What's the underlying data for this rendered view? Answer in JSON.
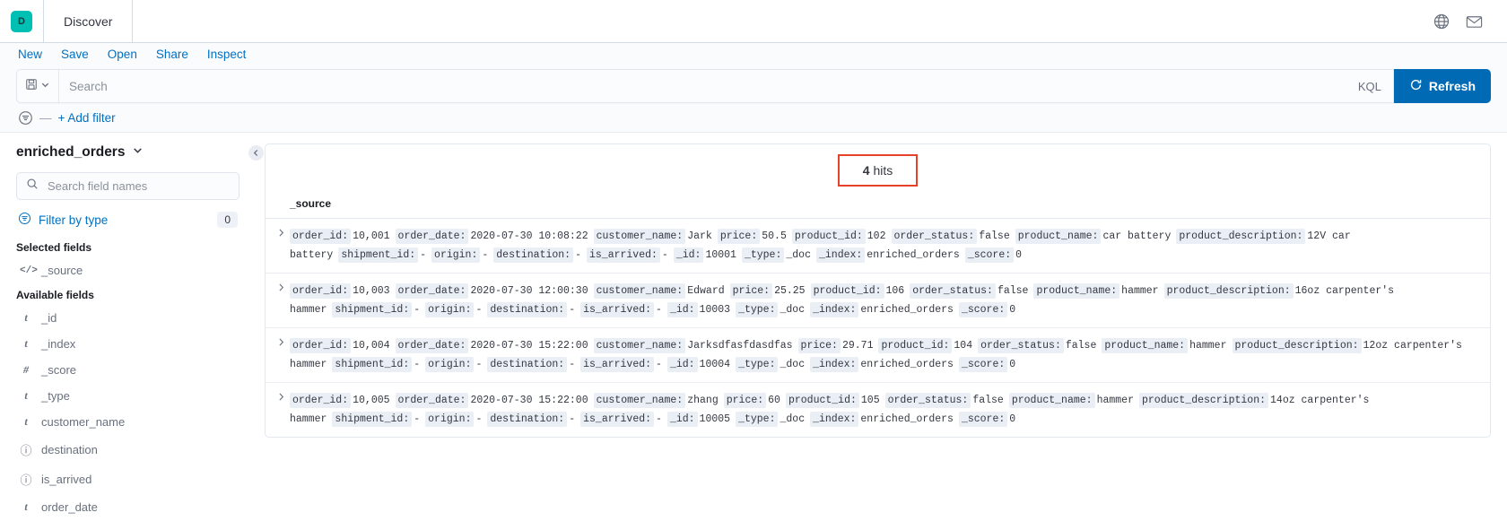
{
  "topbar": {
    "logo_letter": "D",
    "app_title": "Discover",
    "globe_icon": "globe-icon",
    "mail_icon": "mail-icon"
  },
  "menu": {
    "items": [
      {
        "label": "New",
        "name": "menu-new"
      },
      {
        "label": "Save",
        "name": "menu-save"
      },
      {
        "label": "Open",
        "name": "menu-open"
      },
      {
        "label": "Share",
        "name": "menu-share"
      },
      {
        "label": "Inspect",
        "name": "menu-inspect"
      }
    ]
  },
  "query_bar": {
    "saved_query_icon": "save-disk-icon",
    "chevron_icon": "chevron-down-icon",
    "search_value": "",
    "search_placeholder": "Search",
    "language_label": "KQL",
    "refresh_label": "Refresh",
    "refresh_icon": "refresh-icon",
    "refresh_color": "#006bb4"
  },
  "filter_bar": {
    "filter_icon": "filter-icon",
    "separator": "—",
    "add_filter_label": "+ Add filter"
  },
  "sidebar": {
    "index_pattern": "enriched_orders",
    "index_chevron_icon": "chevron-down-icon",
    "field_search_value": "",
    "field_search_placeholder": "Search field names",
    "search_icon": "search-icon",
    "filter_by_type_label": "Filter by type",
    "filter_by_type_icon": "filter-icon",
    "filter_by_type_count": "0",
    "selected_fields_label": "Selected fields",
    "selected_fields": [
      {
        "name": "_source",
        "type_glyph": "</>",
        "type": "source"
      }
    ],
    "available_fields_label": "Available fields",
    "available_fields": [
      {
        "name": "_id",
        "type_glyph": "t",
        "type": "string"
      },
      {
        "name": "_index",
        "type_glyph": "t",
        "type": "string"
      },
      {
        "name": "_score",
        "type_glyph": "#",
        "type": "number"
      },
      {
        "name": "_type",
        "type_glyph": "t",
        "type": "string"
      },
      {
        "name": "customer_name",
        "type_glyph": "t",
        "type": "string"
      },
      {
        "name": "destination",
        "type_glyph": "ⓘ",
        "type": "unknown"
      },
      {
        "name": "is_arrived",
        "type_glyph": "ⓘ",
        "type": "unknown"
      },
      {
        "name": "order_date",
        "type_glyph": "t",
        "type": "string"
      }
    ],
    "collapse_icon": "collapse-panel-icon"
  },
  "results": {
    "hits_count": "4",
    "hits_label": "hits",
    "hits_highlight_color": "#e7412b",
    "column_header": "_source",
    "expand_icon": "chevron-right-icon",
    "rows": [
      {
        "fields": [
          {
            "key": "order_id",
            "value": "10,001"
          },
          {
            "key": "order_date",
            "value": "2020-07-30 10:08:22"
          },
          {
            "key": "customer_name",
            "value": "Jark"
          },
          {
            "key": "price",
            "value": "50.5"
          },
          {
            "key": "product_id",
            "value": "102"
          },
          {
            "key": "order_status",
            "value": "false"
          },
          {
            "key": "product_name",
            "value": "car battery"
          },
          {
            "key": "product_description",
            "value": "12V car battery"
          },
          {
            "key": "shipment_id",
            "value": "-"
          },
          {
            "key": "origin",
            "value": "-"
          },
          {
            "key": "destination",
            "value": "-"
          },
          {
            "key": "is_arrived",
            "value": "-"
          },
          {
            "key": "_id",
            "value": "10001"
          },
          {
            "key": "_type",
            "value": "_doc"
          },
          {
            "key": "_index",
            "value": "enriched_orders"
          },
          {
            "key": "_score",
            "value": "0"
          }
        ]
      },
      {
        "fields": [
          {
            "key": "order_id",
            "value": "10,003"
          },
          {
            "key": "order_date",
            "value": "2020-07-30 12:00:30"
          },
          {
            "key": "customer_name",
            "value": "Edward"
          },
          {
            "key": "price",
            "value": "25.25"
          },
          {
            "key": "product_id",
            "value": "106"
          },
          {
            "key": "order_status",
            "value": "false"
          },
          {
            "key": "product_name",
            "value": "hammer"
          },
          {
            "key": "product_description",
            "value": "16oz carpenter's hammer"
          },
          {
            "key": "shipment_id",
            "value": "-"
          },
          {
            "key": "origin",
            "value": "-"
          },
          {
            "key": "destination",
            "value": "-"
          },
          {
            "key": "is_arrived",
            "value": "-"
          },
          {
            "key": "_id",
            "value": "10003"
          },
          {
            "key": "_type",
            "value": "_doc"
          },
          {
            "key": "_index",
            "value": "enriched_orders"
          },
          {
            "key": "_score",
            "value": "0"
          }
        ]
      },
      {
        "fields": [
          {
            "key": "order_id",
            "value": "10,004"
          },
          {
            "key": "order_date",
            "value": "2020-07-30 15:22:00"
          },
          {
            "key": "customer_name",
            "value": "Jarksdfasfdasdfas"
          },
          {
            "key": "price",
            "value": "29.71"
          },
          {
            "key": "product_id",
            "value": "104"
          },
          {
            "key": "order_status",
            "value": "false"
          },
          {
            "key": "product_name",
            "value": "hammer"
          },
          {
            "key": "product_description",
            "value": "12oz carpenter's hammer"
          },
          {
            "key": "shipment_id",
            "value": "-"
          },
          {
            "key": "origin",
            "value": "-"
          },
          {
            "key": "destination",
            "value": "-"
          },
          {
            "key": "is_arrived",
            "value": "-"
          },
          {
            "key": "_id",
            "value": "10004"
          },
          {
            "key": "_type",
            "value": "_doc"
          },
          {
            "key": "_index",
            "value": "enriched_orders"
          },
          {
            "key": "_score",
            "value": "0"
          }
        ]
      },
      {
        "fields": [
          {
            "key": "order_id",
            "value": "10,005"
          },
          {
            "key": "order_date",
            "value": "2020-07-30 15:22:00"
          },
          {
            "key": "customer_name",
            "value": "zhang"
          },
          {
            "key": "price",
            "value": "60"
          },
          {
            "key": "product_id",
            "value": "105"
          },
          {
            "key": "order_status",
            "value": "false"
          },
          {
            "key": "product_name",
            "value": "hammer"
          },
          {
            "key": "product_description",
            "value": "14oz carpenter's hammer"
          },
          {
            "key": "shipment_id",
            "value": "-"
          },
          {
            "key": "origin",
            "value": "-"
          },
          {
            "key": "destination",
            "value": "-"
          },
          {
            "key": "is_arrived",
            "value": "-"
          },
          {
            "key": "_id",
            "value": "10005"
          },
          {
            "key": "_type",
            "value": "_doc"
          },
          {
            "key": "_index",
            "value": "enriched_orders"
          },
          {
            "key": "_score",
            "value": "0"
          }
        ]
      }
    ]
  }
}
